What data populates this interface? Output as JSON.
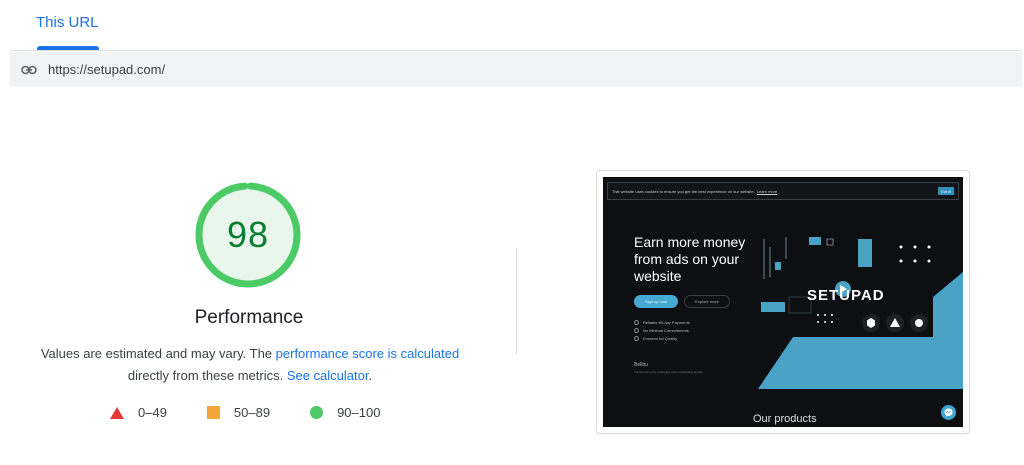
{
  "tabs": [
    {
      "label": "This URL",
      "active": true
    }
  ],
  "url_bar": {
    "icon": "link-icon",
    "url": "https://setupad.com/"
  },
  "score": {
    "value": "98",
    "fraction": 0.98,
    "category": "Performance",
    "color": "#0cce6b"
  },
  "note": {
    "text1": "Values are estimated and may vary. The ",
    "link1": "performance score is calculated",
    "text2": " directly from these metrics. ",
    "link2": "See calculator",
    "text3": "."
  },
  "legend": [
    {
      "shape": "triangle",
      "color": "#e53935",
      "range": "0–49"
    },
    {
      "shape": "square",
      "color": "#f4a53a",
      "range": "50–89"
    },
    {
      "shape": "circle",
      "color": "#4cca66",
      "range": "90–100"
    }
  ],
  "screenshot": {
    "cookie_text": "This website uses cookies to ensure you get the best experience on our website.",
    "cookie_link": "Learn more",
    "cookie_button": "Got it!",
    "headline": "Earn more money from ads on your website",
    "primary_button": "Sign up now",
    "secondary_button": "Explore more",
    "features": [
      "Reliable 60-day Payments",
      "No Minimal Commitments",
      "Ensured Ad Quality"
    ],
    "partner_name": "Belibu",
    "partner_sub": "Transforming the strategies with outstanding growth",
    "logo": "SETUPAD",
    "section_title": "Our products",
    "accent": "#45a9d1"
  }
}
